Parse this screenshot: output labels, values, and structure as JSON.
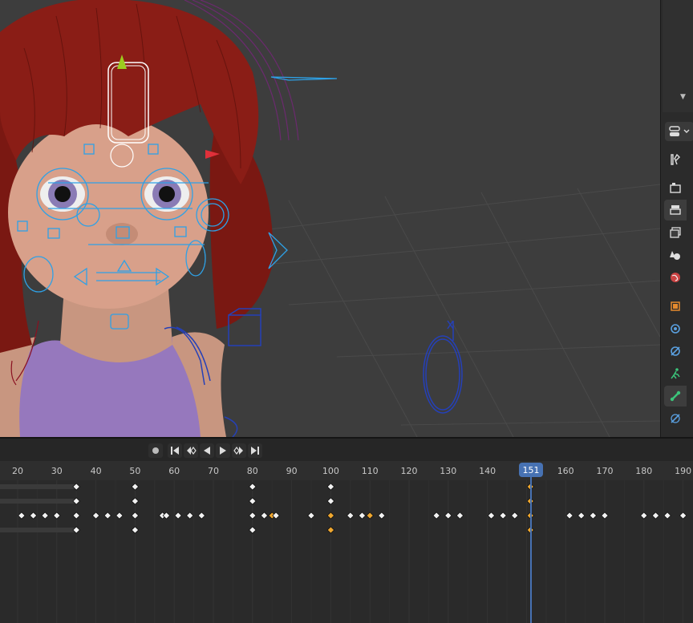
{
  "timeline": {
    "frames": [
      20,
      30,
      40,
      50,
      60,
      70,
      80,
      90,
      100,
      110,
      120,
      130,
      140,
      151,
      160,
      170,
      180,
      190
    ],
    "current_frame": "151",
    "controls": [
      "record-button",
      "jump-start-button",
      "prev-keyframe-button",
      "play-reverse-button",
      "play-button",
      "next-keyframe-button",
      "jump-end-button"
    ]
  },
  "properties_tabs": [
    "tool",
    "render",
    "output",
    "view-layer",
    "scene",
    "world",
    "object",
    "modifiers",
    "particles",
    "physics",
    "constraints",
    "data"
  ],
  "colors": {
    "accent": "#4772b3",
    "selected_key": "#f0a830",
    "bone": "#2ea1e6",
    "hair": "#8a1d16",
    "skin": "#d8a08a",
    "shirt": "#9678bd"
  }
}
